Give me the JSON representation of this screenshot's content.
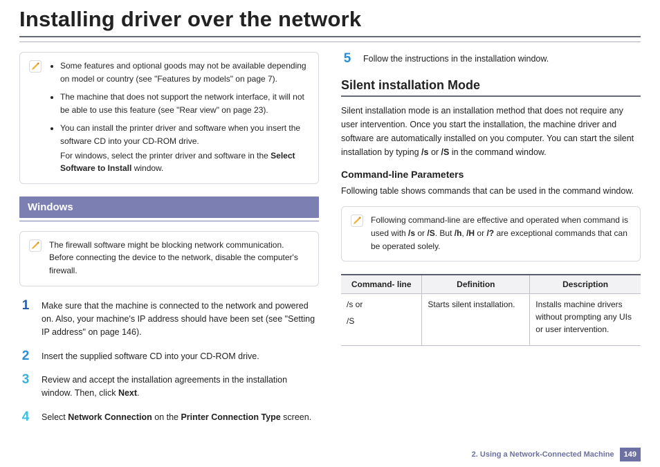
{
  "title": "Installing driver over the network",
  "left": {
    "note1": {
      "bullets": [
        "Some features and optional goods may not be available depending on model or country (see \"Features by models\" on page 7).",
        "The machine that does not support the network interface, it will not be able to use this feature (see \"Rear view\" on page 23).",
        "You can install the printer driver and software when you insert the software CD into your CD-ROM drive."
      ],
      "bullet3_sub_prefix": "For windows, select the printer driver and software in the ",
      "bullet3_sub_bold": "Select Software to Install",
      "bullet3_sub_suffix": " window."
    },
    "section": "Windows",
    "note2": "The firewall software might be blocking network communication. Before connecting the device to the network, disable the computer's firewall.",
    "steps": {
      "s1": "Make sure that the machine is connected to the network and powered on. Also, your machine's IP address should have been set (see \"Setting IP address\" on page 146).",
      "s2": "Insert the supplied software CD into your CD-ROM drive.",
      "s3_pre": "Review and accept the installation agreements in the installation window. Then, click ",
      "s3_bold": "Next",
      "s3_post": ".",
      "s4_pre": "Select ",
      "s4_b1": "Network Connection",
      "s4_mid": " on the ",
      "s4_b2": "Printer Connection Type",
      "s4_post": " screen."
    }
  },
  "right": {
    "step5": "Follow the instructions in the installation window.",
    "h2": "Silent installation Mode",
    "para_pre": "Silent installation mode is an installation method that does not require any user intervention. Once you start the installation, the machine driver and software are automatically installed on you computer. You can start the silent installation by typing ",
    "para_b1": "/s",
    "para_mid1": " or ",
    "para_b2": "/S",
    "para_post": " in the command window.",
    "h3": "Command-line Parameters",
    "para2": "Following table shows commands that can be used in the command window.",
    "note3_pre": "Following command-line are effective and operated when command is used with ",
    "note3_b1": "/s",
    "note3_mid1": " or ",
    "note3_b2": "/S",
    "note3_mid2": ". But ",
    "note3_b3": "/h",
    "note3_mid3": ", ",
    "note3_b4": "/H",
    "note3_mid4": " or ",
    "note3_b5": "/?",
    "note3_post": " are exceptional commands that can be operated solely.",
    "table": {
      "h1": "Command- line",
      "h2": "Definition",
      "h3": "Description",
      "r1c1a": "/s or",
      "r1c1b": "/S",
      "r1c2": "Starts silent installation.",
      "r1c3": "Installs machine drivers without prompting any UIs or user intervention."
    }
  },
  "footer": {
    "chapter": "2.  Using a Network-Connected Machine",
    "page": "149"
  }
}
